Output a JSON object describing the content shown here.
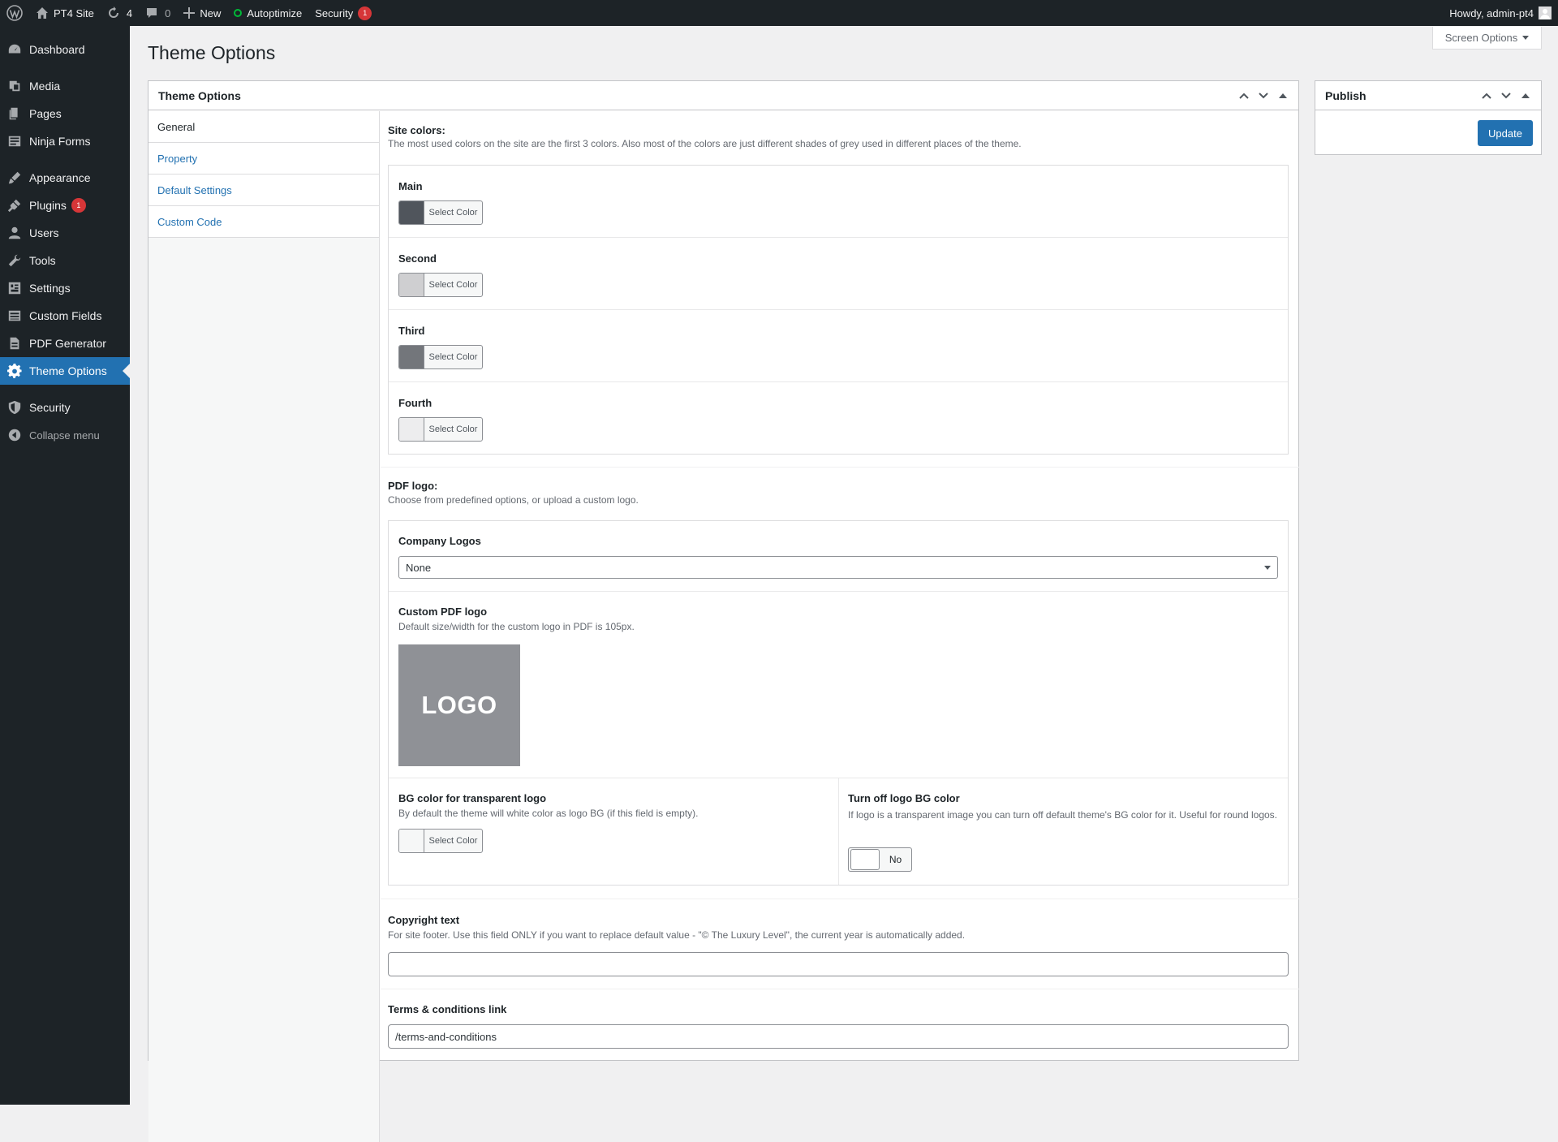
{
  "adminbar": {
    "site_name": "PT4 Site",
    "updates_count": "4",
    "comments_count": "0",
    "new_label": "New",
    "autoptimize_label": "Autoptimize",
    "security_label": "Security",
    "security_badge": "1",
    "howdy": "Howdy, admin-pt4"
  },
  "sidebar": {
    "items": [
      {
        "label": "Dashboard",
        "icon": "dashboard-icon"
      },
      {
        "label": "Media",
        "icon": "media-icon"
      },
      {
        "label": "Pages",
        "icon": "pages-icon"
      },
      {
        "label": "Ninja Forms",
        "icon": "forms-icon"
      },
      {
        "label": "Appearance",
        "icon": "appearance-icon"
      },
      {
        "label": "Plugins",
        "icon": "plugins-icon",
        "badge": "1"
      },
      {
        "label": "Users",
        "icon": "users-icon"
      },
      {
        "label": "Tools",
        "icon": "tools-icon"
      },
      {
        "label": "Settings",
        "icon": "settings-icon"
      },
      {
        "label": "Custom Fields",
        "icon": "custom-fields-icon"
      },
      {
        "label": "PDF Generator",
        "icon": "pdf-icon"
      },
      {
        "label": "Theme Options",
        "icon": "gear-icon",
        "current": true
      },
      {
        "label": "Security",
        "icon": "shield-icon"
      },
      {
        "label": "Collapse menu",
        "icon": "collapse-icon"
      }
    ]
  },
  "page": {
    "title": "Theme Options",
    "screen_options": "Screen Options"
  },
  "options_box": {
    "title": "Theme Options",
    "tabs": [
      "General",
      "Property",
      "Default Settings",
      "Custom Code"
    ],
    "site_colors": {
      "title": "Site colors:",
      "desc": "The most used colors on the site are the first 3 colors. Also most of the colors are just different shades of grey used in different places of the theme.",
      "colors": [
        {
          "label": "Main",
          "button": "Select Color",
          "swatch": "#50555c"
        },
        {
          "label": "Second",
          "button": "Select Color",
          "swatch": "#cfcfd1"
        },
        {
          "label": "Third",
          "button": "Select Color",
          "swatch": "#73767b"
        },
        {
          "label": "Fourth",
          "button": "Select Color",
          "swatch": "#ededee"
        }
      ]
    },
    "pdf_logo": {
      "title": "PDF logo:",
      "desc": "Choose from predefined options, or upload a custom logo.",
      "company_logos_label": "Company Logos",
      "company_logos_value": "None",
      "custom_logo_label": "Custom PDF logo",
      "custom_logo_desc": "Default size/width for the custom logo in PDF is 105px.",
      "logo_text": "LOGO",
      "bg_label": "BG color for transparent logo",
      "bg_desc": "By default the theme will white color as logo BG (if this field is empty).",
      "bg_button": "Select Color",
      "bg_swatch": "#f6f7f7",
      "turnoff_label": "Turn off logo BG color",
      "turnoff_desc": "If logo is a transparent image you can turn off default theme's BG color for it. Useful for round logos.",
      "turnoff_value": "No"
    },
    "copyright": {
      "title": "Copyright text",
      "desc": "For site footer. Use this field ONLY if you want to replace default value - \"© The Luxury Level\", the current year is automatically added.",
      "value": ""
    },
    "terms": {
      "title": "Terms & conditions link",
      "value": "/terms-and-conditions"
    }
  },
  "publish_box": {
    "title": "Publish",
    "update_label": "Update"
  },
  "colors": {
    "accent": "#2271b1",
    "sidebar_bg": "#1d2327",
    "badge": "#d63638"
  }
}
